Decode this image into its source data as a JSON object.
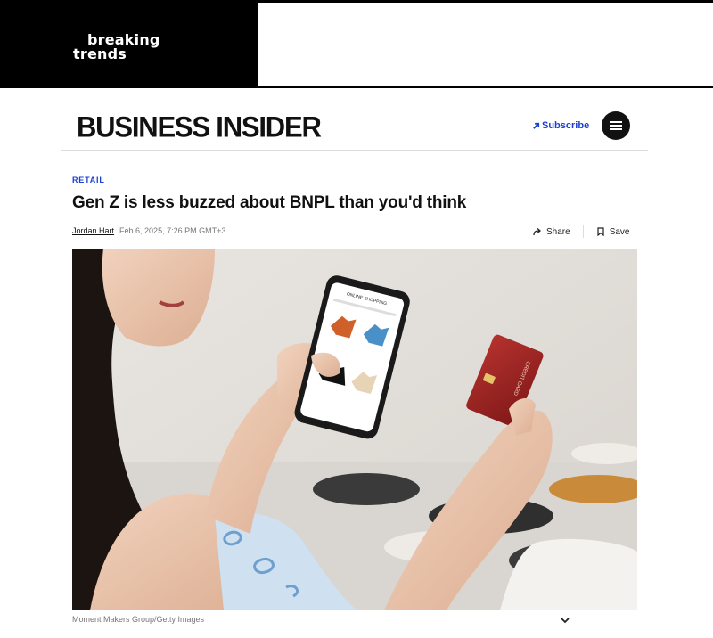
{
  "top_banner": {
    "logo_line1": "breaking",
    "logo_line2": "trends"
  },
  "header": {
    "logo": "BUSINESS INSIDER",
    "subscribe_label": "Subscribe",
    "subscribe_icon": "arrow-up-right-icon",
    "menu_icon": "hamburger-menu-icon"
  },
  "article": {
    "category": "RETAIL",
    "headline": "Gen Z is less buzzed about BNPL than you'd think",
    "author": "Jordan Hart",
    "date": "Feb 6, 2025, 7:26 PM GMT+3",
    "share_label": "Share",
    "save_label": "Save",
    "image_caption": "Moment Makers Group/Getty Images",
    "card_text": "CREDIT CARD",
    "phone_screen_text": "ONLINE SHOPPING"
  },
  "colors": {
    "accent": "#1a3fd6",
    "banner_bg": "#000000"
  }
}
